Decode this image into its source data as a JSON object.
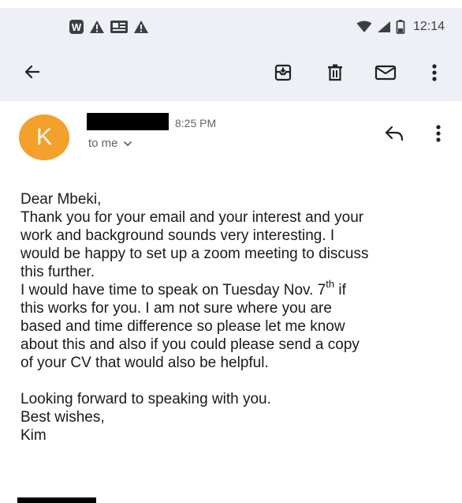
{
  "status_bar": {
    "time": "12:14",
    "left_icons": [
      "w-app-icon",
      "alert-icon",
      "news-icon",
      "alert-icon"
    ],
    "right_icons": [
      "wifi-icon",
      "signal-icon",
      "battery-icon"
    ]
  },
  "toolbar": {
    "actions": [
      "back-arrow-icon",
      "archive-icon",
      "delete-icon",
      "mark-unread-icon",
      "more-vert-icon"
    ]
  },
  "message": {
    "avatar_letter": "K",
    "avatar_color": "#f4a12c",
    "time": "8:25 PM",
    "recipient_label": "to me"
  },
  "body": {
    "greeting": "Dear Mbeki,",
    "lines_para1": [
      "Thank you for your email and your interest and your",
      "work and background sounds very interesting.  I",
      "would be happy to set up a zoom meeting to discuss",
      "this further."
    ],
    "para2_line1_before": "I would have time to speak on Tuesday Nov. 7",
    "para2_line1_sup": "th",
    "para2_line1_after": " if",
    "lines_para2": [
      "this works for you.  I  am not sure where you are",
      "based and time difference so please let me know",
      "about this and also if you could please send a copy",
      "of your CV that would also be helpful."
    ],
    "closing": "Looking forward to speaking with you.",
    "signoff": "Best wishes,",
    "signature": "Kim"
  }
}
